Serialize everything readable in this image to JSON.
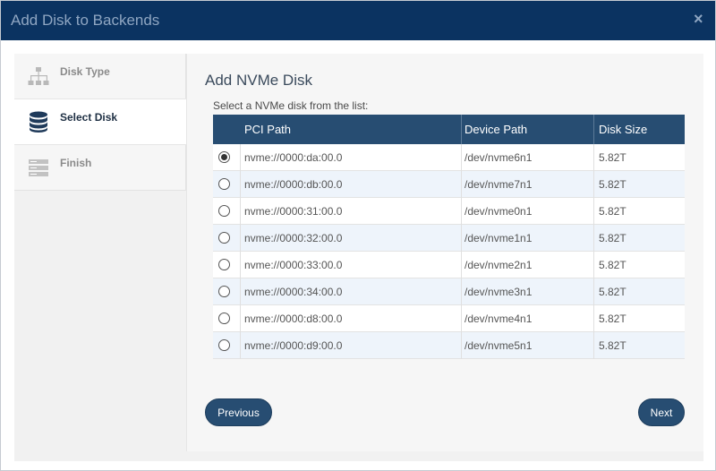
{
  "window": {
    "title": "Add Disk to Backends",
    "close_icon": "×"
  },
  "steps": [
    {
      "label": "Disk Type",
      "icon": "hierarchy-icon",
      "active": false
    },
    {
      "label": "Select Disk",
      "icon": "database-icon",
      "active": true
    },
    {
      "label": "Finish",
      "icon": "server-stack-icon",
      "active": false
    }
  ],
  "panel": {
    "title": "Add NVMe Disk",
    "hint": "Select a NVMe disk from the list:",
    "columns": [
      "PCI Path",
      "Device Path",
      "Disk Size"
    ],
    "rows": [
      {
        "pci": "nvme://0000:da:00.0",
        "device": "/dev/nvme6n1",
        "size": "5.82T",
        "selected": true
      },
      {
        "pci": "nvme://0000:db:00.0",
        "device": "/dev/nvme7n1",
        "size": "5.82T",
        "selected": false
      },
      {
        "pci": "nvme://0000:31:00.0",
        "device": "/dev/nvme0n1",
        "size": "5.82T",
        "selected": false
      },
      {
        "pci": "nvme://0000:32:00.0",
        "device": "/dev/nvme1n1",
        "size": "5.82T",
        "selected": false
      },
      {
        "pci": "nvme://0000:33:00.0",
        "device": "/dev/nvme2n1",
        "size": "5.82T",
        "selected": false
      },
      {
        "pci": "nvme://0000:34:00.0",
        "device": "/dev/nvme3n1",
        "size": "5.82T",
        "selected": false
      },
      {
        "pci": "nvme://0000:d8:00.0",
        "device": "/dev/nvme4n1",
        "size": "5.82T",
        "selected": false
      },
      {
        "pci": "nvme://0000:d9:00.0",
        "device": "/dev/nvme5n1",
        "size": "5.82T",
        "selected": false
      }
    ]
  },
  "buttons": {
    "previous": "Previous",
    "next": "Next"
  },
  "colors": {
    "titlebar": "#0b3361",
    "accent": "#274d72",
    "row_alt": "#eef4fb"
  }
}
